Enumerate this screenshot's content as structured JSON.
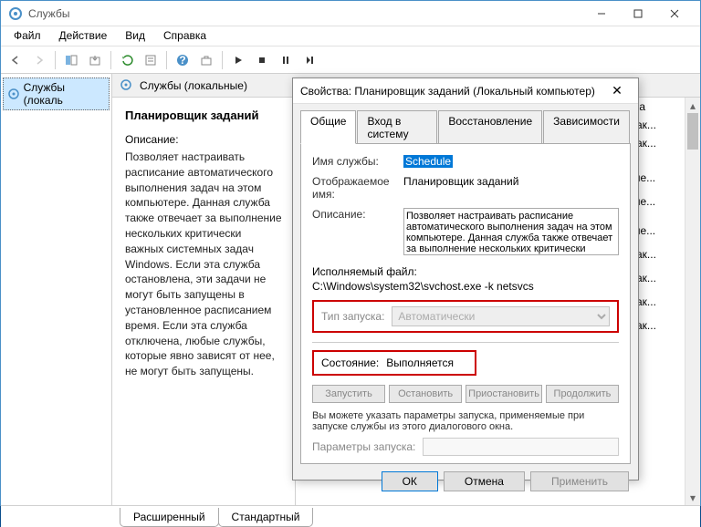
{
  "window": {
    "title": "Службы",
    "menu": {
      "file": "Файл",
      "action": "Действие",
      "view": "Вид",
      "help": "Справка"
    },
    "leftpane_node": "Службы (локаль",
    "subheader": "Службы (локальные)",
    "bottom_tabs": {
      "extended": "Расширенный",
      "standard": "Стандартный"
    }
  },
  "detail": {
    "name": "Планировщик заданий",
    "desc_label": "Описание:",
    "desc_text": "Позволяет настраивать расписание автоматического выполнения задач на этом компьютере. Данная служба также отвечает за выполнение нескольких критически важных системных задач Windows. Если эта служба остановлена, эти задачи не могут быть запущены в установленное расписанием время. Если эта служба отключена, любые службы, которые явно зависят от нее, не могут быть запущены."
  },
  "list_items": [
    "уска",
    "о (ак...",
    "о (ак...",
    "",
    "",
    "",
    "тиче...",
    "",
    "тиче...",
    "",
    "",
    "тиче...",
    "",
    "о (ак...",
    "",
    "о (ак...",
    "",
    "о (ак...",
    "",
    "о (ак..."
  ],
  "dialog": {
    "title": "Свойства: Планировщик заданий (Локальный компьютер)",
    "tabs": {
      "general": "Общие",
      "logon": "Вход в систему",
      "recovery": "Восстановление",
      "deps": "Зависимости"
    },
    "labels": {
      "service_name": "Имя службы:",
      "display_name": "Отображаемое имя:",
      "description": "Описание:",
      "exe": "Исполняемый файл:",
      "startup": "Тип запуска:",
      "status": "Состояние:",
      "params": "Параметры запуска:"
    },
    "values": {
      "service_name": "Schedule",
      "display_name": "Планировщик заданий",
      "description": "Позволяет настраивать расписание автоматического выполнения задач на этом компьютере. Данная служба также отвечает за выполнение нескольких критически важных",
      "exe": "C:\\Windows\\system32\\svchost.exe -k netsvcs",
      "startup": "Автоматически",
      "status": "Выполняется"
    },
    "buttons": {
      "start": "Запустить",
      "stop": "Остановить",
      "pause": "Приостановить",
      "resume": "Продолжить"
    },
    "note": "Вы можете указать параметры запуска, применяемые при запуске службы из этого диалогового окна.",
    "dlg_buttons": {
      "ok": "ОК",
      "cancel": "Отмена",
      "apply": "Применить"
    }
  }
}
